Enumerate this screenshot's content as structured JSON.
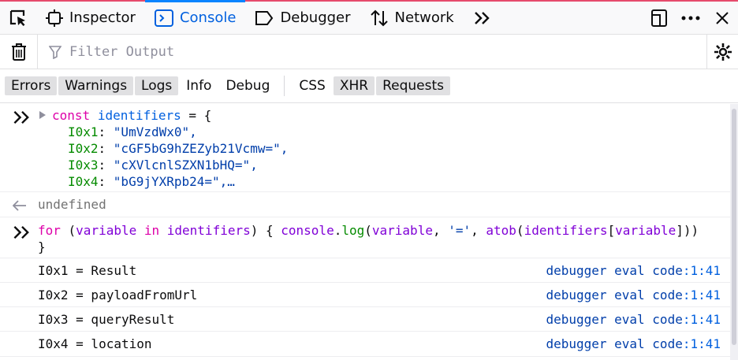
{
  "toolbar": {
    "tabs": [
      {
        "label": "Inspector",
        "icon": "inspector-icon"
      },
      {
        "label": "Console",
        "icon": "console-icon",
        "active": true
      },
      {
        "label": "Debugger",
        "icon": "debugger-icon"
      },
      {
        "label": "Network",
        "icon": "network-icon"
      }
    ],
    "overflow_icon": "chevrons-right-icon",
    "right_icons": [
      "dock-side-icon",
      "more-options-icon",
      "close-icon"
    ]
  },
  "filter": {
    "placeholder": "Filter Output"
  },
  "levels": {
    "items": [
      "Errors",
      "Warnings",
      "Logs",
      "Info",
      "Debug"
    ],
    "extra": [
      "CSS",
      "XHR",
      "Requests"
    ]
  },
  "console": {
    "entry1": {
      "keyword": "const",
      "name": "identifiers",
      "eq": " = {",
      "props": [
        {
          "key": "I0x1",
          "value": "\"UmVzdWx0\","
        },
        {
          "key": "I0x2",
          "value": "\"cGF5bG9hZEZyb21Vcmw=\","
        },
        {
          "key": "I0x3",
          "value": "\"cXVlcnlSZXN1bHQ=\","
        },
        {
          "key": "I0x4",
          "value": "\"bG9jYXRpb24=\",…"
        }
      ]
    },
    "result1": "undefined",
    "entry2": {
      "for": "for",
      "p1": " (",
      "variable": "variable",
      "in": " in ",
      "identifiers": "identifiers",
      "p2": ") { ",
      "console": "console",
      "dot": ".",
      "log": "log",
      "p3": "(",
      "variable2": "variable",
      "comma": ", ",
      "eqstr": "'='",
      "comma2": ", ",
      "atob": "atob",
      "p4": "(",
      "identifiers2": "identifiers",
      "p5": "[",
      "variable3": "variable",
      "p6": "]))",
      "close": "}"
    },
    "logs": [
      {
        "text": "I0x1 = Result",
        "source": "debugger eval code",
        "loc": ":1:41"
      },
      {
        "text": "I0x2 = payloadFromUrl",
        "source": "debugger eval code",
        "loc": ":1:41"
      },
      {
        "text": "I0x3 = queryResult",
        "source": "debugger eval code",
        "loc": ":1:41"
      },
      {
        "text": "I0x4 = location",
        "source": "debugger eval code",
        "loc": ":1:41"
      }
    ]
  }
}
